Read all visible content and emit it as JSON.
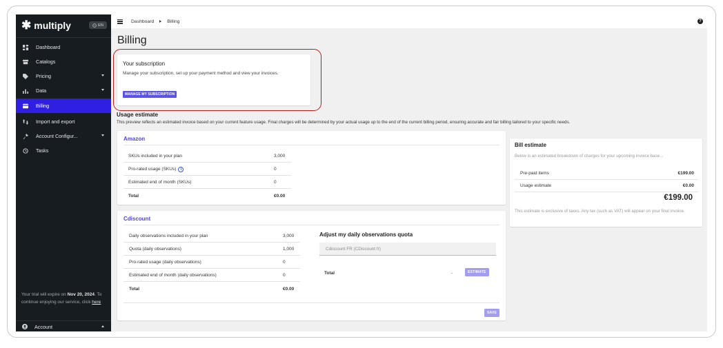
{
  "sidebar": {
    "brand": "multiply",
    "language": "EN",
    "items": [
      {
        "label": "Dashboard",
        "icon": "dashboard-icon"
      },
      {
        "label": "Catalogs",
        "icon": "catalog-icon"
      },
      {
        "label": "Pricing",
        "icon": "tag-icon",
        "expandable": true
      },
      {
        "label": "Data",
        "icon": "bar-chart-icon",
        "expandable": true
      },
      {
        "label": "Billing",
        "icon": "credit-card-icon",
        "active": true
      },
      {
        "label": "Import and export",
        "icon": "import-export-icon"
      },
      {
        "label": "Account Configur...",
        "icon": "wrench-icon",
        "expandable": true
      },
      {
        "label": "Tasks",
        "icon": "history-icon"
      }
    ],
    "trial": {
      "prefix": "Your trial will expire on ",
      "date": "Nov 20, 2024",
      "middle": ". To continue enjoying our service, click ",
      "link": "here"
    },
    "account_label": "Account"
  },
  "topbar": {
    "breadcrumb": [
      "Dashboard",
      "Billing"
    ],
    "help": "?"
  },
  "page_title": "Billing",
  "subscription": {
    "title": "Your subscription",
    "description": "Manage your subscription, set up your payment method and view your invoices.",
    "button": "MANAGE MY SUBSCRIPTION"
  },
  "usage": {
    "title": "Usage estimate",
    "description": "This preview reflects an estimated invoice based on your current feature usage. Final charges will be determined by your actual usage up to the end of the current billing period, ensuring accurate and fair billing tailored to your specific needs."
  },
  "amazon": {
    "title": "Amazon",
    "rows": [
      {
        "label": "SKUs included in your plan",
        "value": "3,000"
      },
      {
        "label": "Pro-rated usage (SKUs)",
        "value": "0",
        "info": true
      },
      {
        "label": "Estimated end of month (SKUs)",
        "value": "0"
      },
      {
        "label": "Total",
        "value": "€0.00",
        "total": true
      }
    ]
  },
  "cdiscount": {
    "title": "Cdiscount",
    "rows": [
      {
        "label": "Daily observations included in your plan",
        "value": "3,000"
      },
      {
        "label": "Quota (daily observations)",
        "value": "1,000"
      },
      {
        "label": "Pro-rated usage (daily observations)",
        "value": "0"
      },
      {
        "label": "Estimated end of month (daily observations)",
        "value": "0"
      },
      {
        "label": "Total",
        "value": "€0.00",
        "total": true
      }
    ],
    "adjust_title": "Adjust my daily observations quota",
    "select_value": "Cdiscount FR (CDiscount fr)",
    "total_label": "Total",
    "total_value": "-",
    "estimate_button": "ESTIMATE",
    "save_button": "SAVE"
  },
  "bill": {
    "title": "Bill estimate",
    "description": "Below is an estimated breakdown of charges for your upcoming invoice base...",
    "rows": [
      {
        "label": "Pre-paid items",
        "value": "€199.00"
      },
      {
        "label": "Usage estimate",
        "value": "€0.00"
      }
    ],
    "total": "€199.00",
    "note": "This estimate is exclusive of taxes. Any tax (such as VAT) will appear on your final invoice."
  },
  "colors": {
    "accent": "#5144d8",
    "sidebar_bg": "#161c20",
    "active_nav": "#2f1fe3",
    "button": "#5b52e7",
    "button_disabled": "#a29df0",
    "highlight": "#b81d1d"
  }
}
